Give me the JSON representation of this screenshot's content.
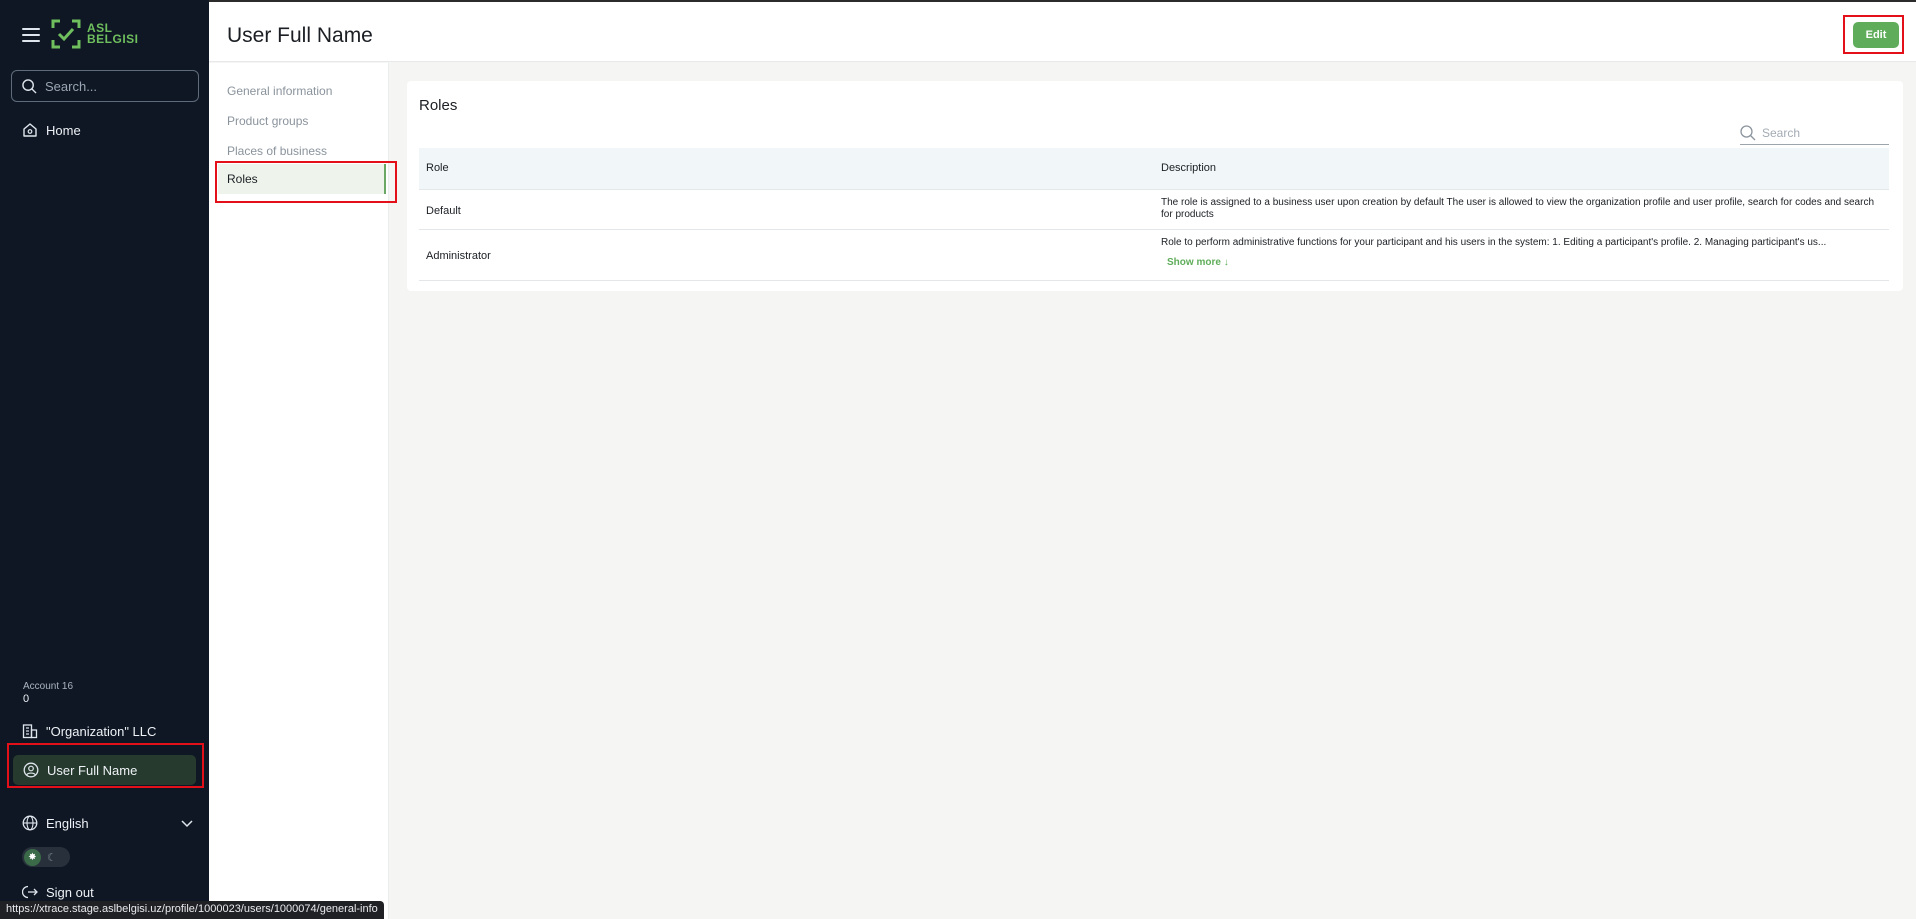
{
  "sidebar": {
    "logo_text_line1": "ASL",
    "logo_text_line2": "BELGISI",
    "search_placeholder": "Search...",
    "home_label": "Home",
    "account_label": "Account 16",
    "account_value": "0",
    "org_label": "\"Organization\" LLC",
    "user_label": "User Full Name",
    "language_label": "English",
    "signout_label": "Sign out"
  },
  "status_bar": {
    "url": "https://xtrace.stage.aslbelgisi.uz/profile/1000023/users/1000074/general-info"
  },
  "header": {
    "title": "User Full Name",
    "edit_label": "Edit"
  },
  "subnav": {
    "items": [
      {
        "label": "General information"
      },
      {
        "label": "Product groups"
      },
      {
        "label": "Places of business"
      },
      {
        "label": "Roles"
      }
    ]
  },
  "roles": {
    "title": "Roles",
    "search_placeholder": "Search",
    "columns": [
      "Role",
      "Description"
    ],
    "rows": [
      {
        "role": "Default",
        "description": "The role is assigned to a business user upon creation by default The user is allowed to view the organization profile and user profile, search for codes and search for products"
      },
      {
        "role": "Administrator",
        "description": "Role to perform administrative functions for your participant and his users in the system: 1. Editing a participant's profile. 2. Managing participant's us...",
        "show_more": "Show more"
      }
    ]
  },
  "colors": {
    "sidebar_bg": "#0f1724",
    "accent_green": "#5fad5a",
    "highlight_red": "#e3101a"
  }
}
